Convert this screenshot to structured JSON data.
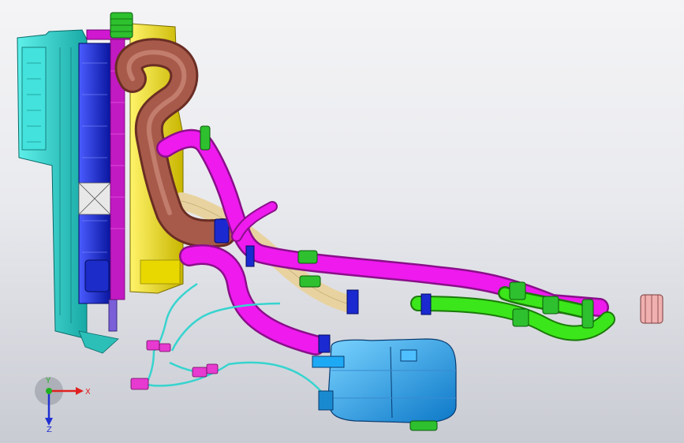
{
  "viewport": {
    "background_top": "#f4f4f6",
    "background_bottom": "#c9cbd3"
  },
  "triad": {
    "x_label": "X",
    "y_label": "Y",
    "z_label": "Z",
    "x_color": "#e02020",
    "y_color": "#20b020",
    "z_color": "#2030d0"
  },
  "components": {
    "radiator_color": "#25d6cf",
    "core_color": "#1f2fd8",
    "frame_color": "#d018d0",
    "fan_shroud_color": "#f2e521",
    "intake_duct_color": "#a85a4a",
    "coolant_hose_color": "#ee1aee",
    "heater_hose_color": "#3be61a",
    "tan_hose_color": "#e8d3a0",
    "reservoir_color": "#1ea9f5",
    "cap_color": "#2ec02e",
    "sensor_wire_color": "#37d4cf",
    "connector_color": "#d8a0a0"
  }
}
